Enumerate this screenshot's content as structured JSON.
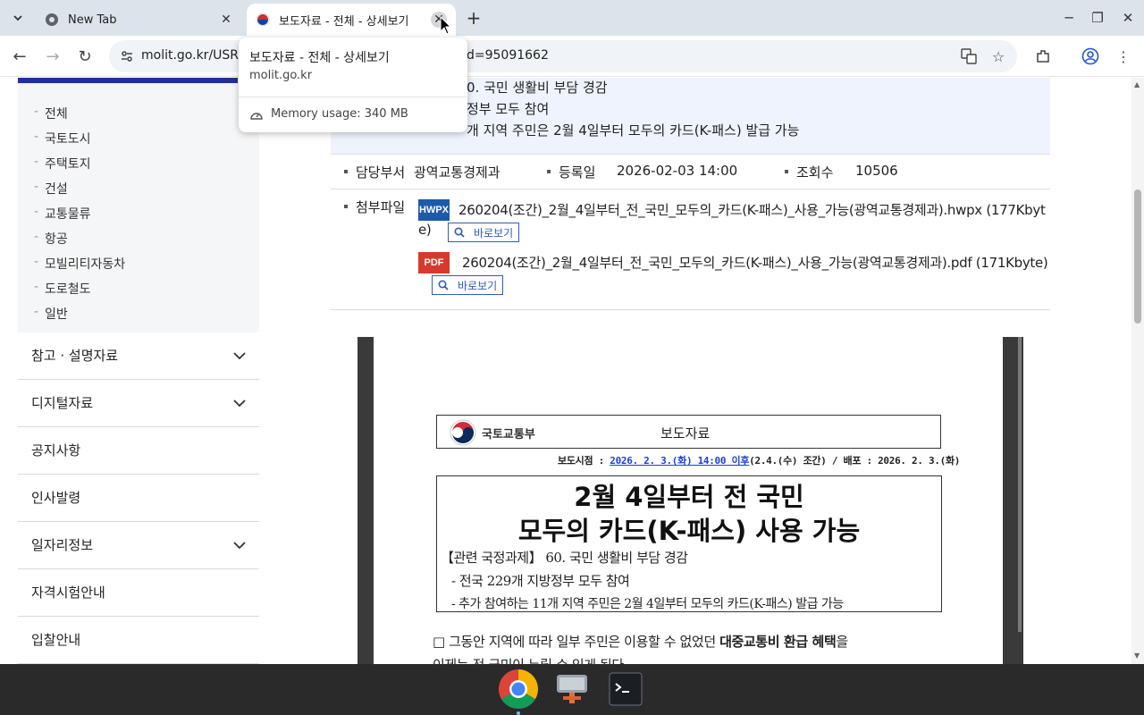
{
  "browser": {
    "tabs": [
      {
        "title": "New Tab",
        "active": false
      },
      {
        "title": "보도자료 - 전체 - 상세보기",
        "active": true
      }
    ],
    "url_visible": "molit.go.kr/USR",
    "url_tail": "d=95091662",
    "hovercard": {
      "title": "보도자료 - 전체 - 상세보기",
      "domain": "molit.go.kr",
      "memory": "Memory usage: 340 MB"
    }
  },
  "sidebar": {
    "submenu": [
      "전체",
      "국토도시",
      "주택토지",
      "건설",
      "교통물류",
      "항공",
      "모빌리티자동차",
      "도로철도",
      "일반"
    ],
    "menu": [
      {
        "label": "참고 · 설명자료",
        "expandable": true
      },
      {
        "label": "디지털자료",
        "expandable": true
      },
      {
        "label": "공지사항",
        "expandable": false
      },
      {
        "label": "인사발령",
        "expandable": false
      },
      {
        "label": "일자리정보",
        "expandable": true
      },
      {
        "label": "자격시험안내",
        "expandable": false
      },
      {
        "label": "입찰안내",
        "expandable": false
      }
    ]
  },
  "article": {
    "summary_lines": [
      "0. 국민 생활비 부담 경감",
      "정부 모두 참여",
      "개 지역 주민은 2월 4일부터 모두의 카드(K-패스) 발급 가능"
    ],
    "meta": {
      "dept_label": "담당부서",
      "dept_value": "광역교통경제과",
      "date_label": "등록일",
      "date_value": "2026-02-03 14:00",
      "views_label": "조회수",
      "views_value": "10506"
    },
    "attach_label": "첨부파일",
    "attachments": [
      {
        "badge": "HWPX",
        "name_line1": "260204(조간)_2월_4일부터_전_국민_모두의_카드(K-패스)_사용_가능(광역교통경제과).hwpx (177Kbyt",
        "name_line2": "e)",
        "view": "바로보기"
      },
      {
        "badge": "PDF",
        "name_line1": "260204(조간)_2월_4일부터_전_국민_모두의_카드(K-패스)_사용_가능(광역교통경제과).pdf (171Kbyte)",
        "view": "바로보기"
      }
    ]
  },
  "document": {
    "ministry": "국토교통부",
    "kind": "보도자료",
    "release_prefix": "보도시점 : ",
    "release_time": "2026. 2. 3.(화) 14:00 이후",
    "release_suffix": "(2.4.(수) 조간) / 배포 : 2026. 2. 3.(화)",
    "title_line1": "2월 4일부터 전 국민",
    "title_line2": "모두의 카드(K-패스) 사용 가능",
    "related": "【관련 국정과제】 60. 국민 생활비 부담 경감",
    "bullet1": "- 전국 229개 지방정부 모두 참여",
    "bullet2": "- 추가 참여하는 11개 지역 주민은 2월 4일부터 모두의 카드(K-패스) 발급 가능",
    "body_a": "□ 그동안 지역에 따라 일부 주민은 이용할 수 없었던 ",
    "body_bold": "대중교통비 환급 혜택",
    "body_b": "을",
    "body_line2": "이제는 전 국민이 누릴 수 있게 된다"
  },
  "colors": {
    "tabbar": "#dde3ea",
    "accent": "#23309a",
    "summary_bg": "#eef3fd",
    "hwpx": "#1e5aa8",
    "pdf": "#d73a2c",
    "link": "#2f5cb8"
  }
}
